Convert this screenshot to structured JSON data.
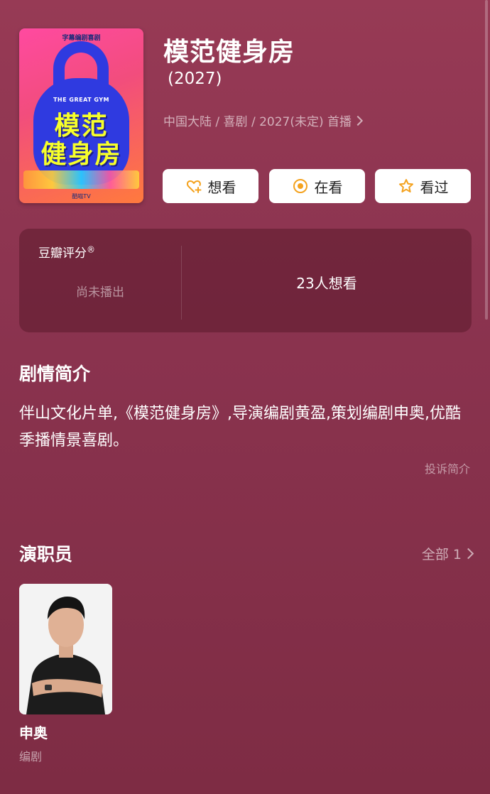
{
  "show": {
    "title": "模范健身房",
    "year": "(2027)",
    "meta": "中国大陆 / 喜剧 / 2027(未定) 首播"
  },
  "poster": {
    "top_text": "字幕编剧喜剧",
    "subtitle": "THE GREAT GYM",
    "title_line1": "模范",
    "title_line2": "健身房",
    "bottom_text": "酷喵TV"
  },
  "actions": {
    "want_label": "想看",
    "watching_label": "在看",
    "watched_label": "看过"
  },
  "rating": {
    "label": "豆瓣评分",
    "registered_mark": "®",
    "status": "尚未播出",
    "wish_count": "23人想看"
  },
  "synopsis": {
    "heading": "剧情简介",
    "text": "伴山文化片单,《模范健身房》,导演编剧黄盈,策划编剧申奥,优酷季播情景喜剧。",
    "complain_link": "投诉简介"
  },
  "cast": {
    "heading": "演职员",
    "all_label": "全部 1",
    "members": [
      {
        "name": "申奥",
        "role": "编剧"
      }
    ]
  },
  "colors": {
    "background": "#8c3450",
    "accent_orange": "#f4a21e",
    "card_bg": "#5a1a2c"
  }
}
